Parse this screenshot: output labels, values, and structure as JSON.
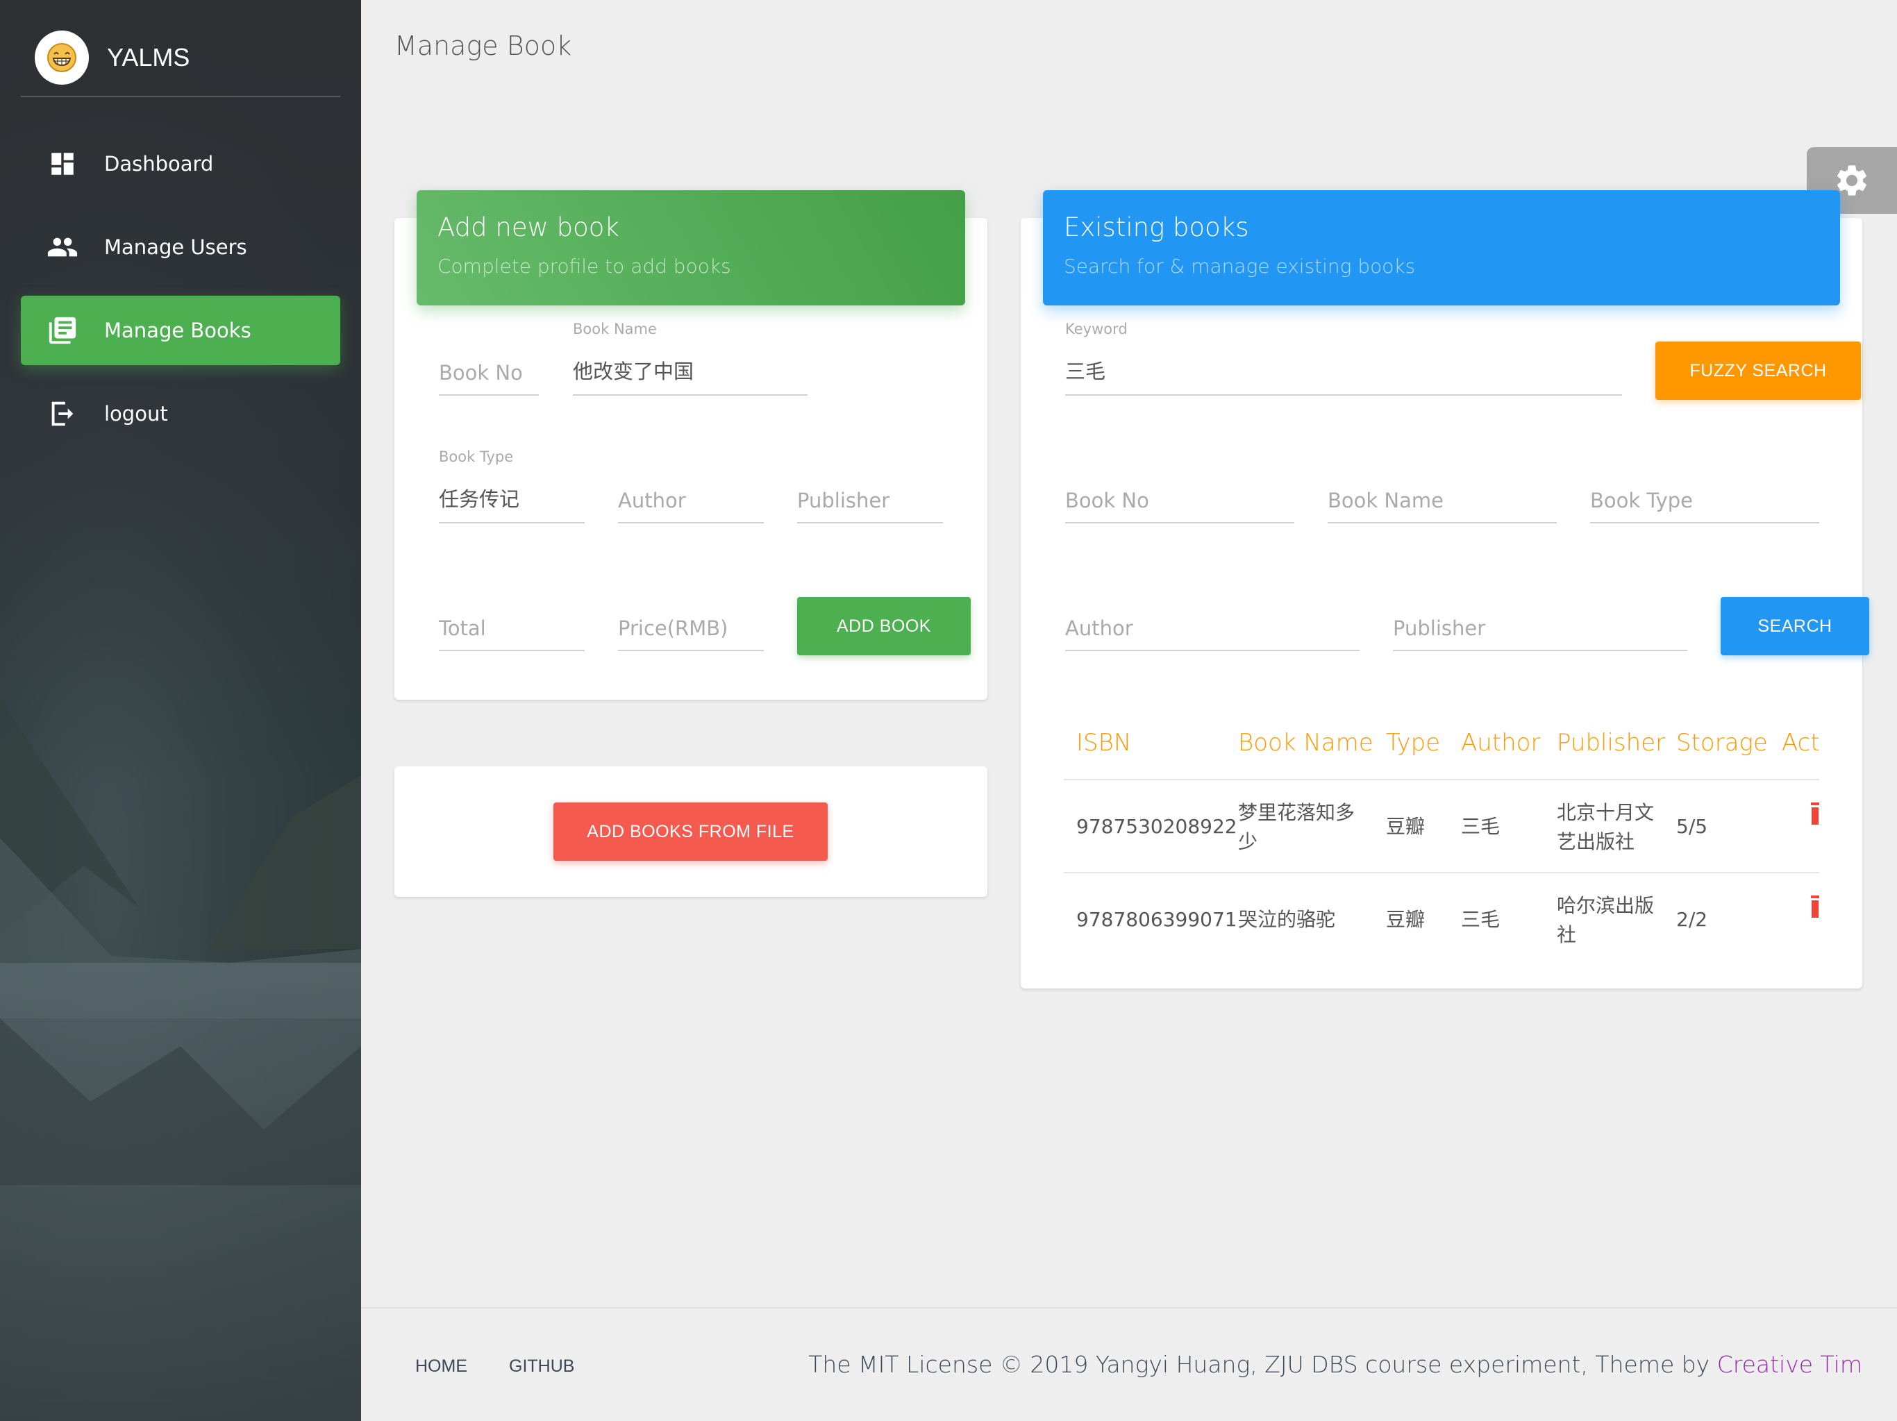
{
  "app": {
    "name": "YALMS"
  },
  "sidebar": {
    "items": [
      {
        "label": "Dashboard",
        "icon": "dashboard-icon",
        "active": false
      },
      {
        "label": "Manage Users",
        "icon": "people-icon",
        "active": false
      },
      {
        "label": "Manage Books",
        "icon": "library-books-icon",
        "active": true
      },
      {
        "label": "logout",
        "icon": "logout-icon",
        "active": false
      }
    ]
  },
  "page": {
    "title": "Manage Book"
  },
  "add_book": {
    "title": "Add new book",
    "subtitle": "Complete profile to add books",
    "book_no": {
      "placeholder": "Book No",
      "value": ""
    },
    "book_name": {
      "label": "Book Name",
      "value": "他改变了中国"
    },
    "book_type": {
      "label": "Book Type",
      "value": "任务传记"
    },
    "author": {
      "placeholder": "Author",
      "value": ""
    },
    "publisher": {
      "placeholder": "Publisher",
      "value": ""
    },
    "total": {
      "placeholder": "Total",
      "value": ""
    },
    "price": {
      "placeholder": "Price(RMB)",
      "value": ""
    },
    "add_button": "ADD BOOK"
  },
  "add_from_file": {
    "button": "ADD BOOKS FROM FILE"
  },
  "existing": {
    "title": "Existing books",
    "subtitle": "Search for & manage existing books",
    "keyword": {
      "label": "Keyword",
      "value": "三毛"
    },
    "fuzzy_button": "FUZZY SEARCH",
    "book_no": {
      "placeholder": "Book No"
    },
    "book_name": {
      "placeholder": "Book Name"
    },
    "book_type": {
      "placeholder": "Book Type"
    },
    "author": {
      "placeholder": "Author"
    },
    "publisher": {
      "placeholder": "Publisher"
    },
    "search_button": "SEARCH",
    "columns": [
      "ISBN",
      "Book Name",
      "Type",
      "Author",
      "Publisher",
      "Storage",
      "Act"
    ],
    "rows": [
      {
        "isbn": "9787530208922",
        "name_l1": "梦里花落知多",
        "name_l2": "少",
        "type": "豆瓣",
        "author": "三毛",
        "pub_l1": "北京十月文",
        "pub_l2": "艺出版社",
        "storage": "5/5"
      },
      {
        "isbn": "9787806399071",
        "name_l1": "哭泣的骆驼",
        "name_l2": "",
        "type": "豆瓣",
        "author": "三毛",
        "pub_l1": "哈尔滨出版",
        "pub_l2": "社",
        "storage": "2/2"
      }
    ]
  },
  "footer": {
    "links": [
      "HOME",
      "GITHUB"
    ],
    "copyright": "The MIT License © 2019 Yangyi Huang, ZJU DBS course experiment, Theme by ",
    "credit": "Creative Tim"
  },
  "colors": {
    "green": "#4caf50",
    "blue": "#2196f3",
    "orange": "#ff9800",
    "red": "#f55a4e",
    "purple": "#9c27b0"
  }
}
